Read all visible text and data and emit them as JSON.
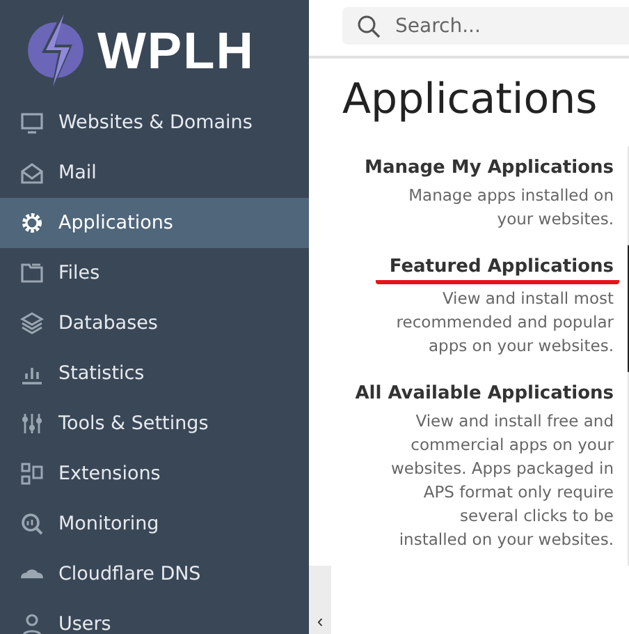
{
  "logo": {
    "text": "WPLH"
  },
  "sidebar": {
    "items": [
      {
        "label": "Websites & Domains",
        "selected": false
      },
      {
        "label": "Mail",
        "selected": false
      },
      {
        "label": "Applications",
        "selected": true
      },
      {
        "label": "Files",
        "selected": false
      },
      {
        "label": "Databases",
        "selected": false
      },
      {
        "label": "Statistics",
        "selected": false
      },
      {
        "label": "Tools & Settings",
        "selected": false
      },
      {
        "label": "Extensions",
        "selected": false
      },
      {
        "label": "Monitoring",
        "selected": false
      },
      {
        "label": "Cloudflare DNS",
        "selected": false
      },
      {
        "label": "Users",
        "selected": false
      }
    ]
  },
  "collapse_button": {
    "label": "‹"
  },
  "search": {
    "placeholder": "Search..."
  },
  "page_title": "Applications",
  "sections": [
    {
      "title": "Manage My Applications",
      "description": "Manage apps installed on your websites.",
      "selected": false,
      "underlined": false
    },
    {
      "title": "Featured Applications",
      "description": "View and install most recommended and popular apps on your websites.",
      "selected": true,
      "underlined": true
    },
    {
      "title": "All Available Applications",
      "description": "View and install free and commercial apps on your websites. Apps packaged in APS format only require several clicks to be installed on your websites.",
      "selected": false,
      "underlined": false
    }
  ]
}
